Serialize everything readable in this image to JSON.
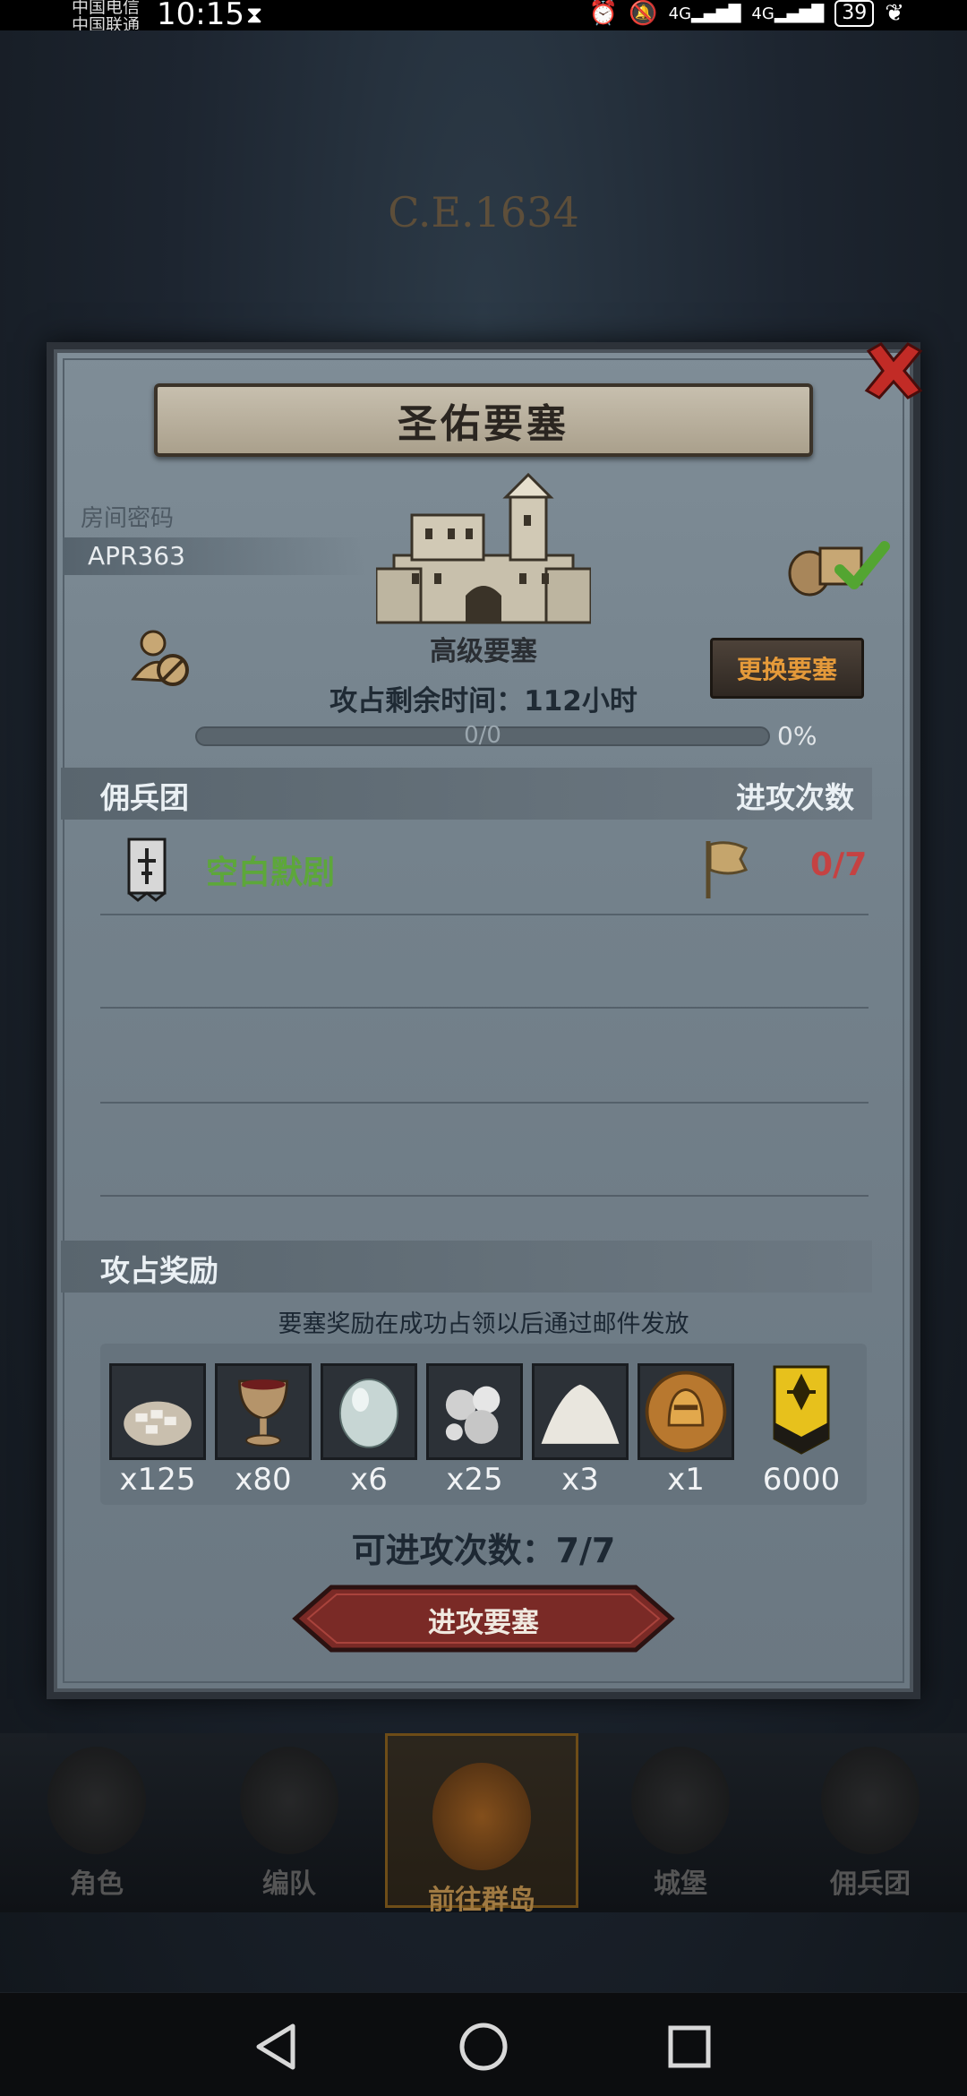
{
  "status_bar": {
    "carrier_1": "中国电信",
    "carrier_2": "中国联通",
    "time": "10:15",
    "network_1": "4G",
    "network_2": "4G",
    "battery": "39"
  },
  "background": {
    "era": "C.E.1634"
  },
  "dialog": {
    "title": "圣佑要塞",
    "room_code_label": "房间密码",
    "room_code": "APR363",
    "fortress_level": "高级要塞",
    "time_left": "攻占剩余时间：112小时",
    "switch_button": "更换要塞",
    "progress": {
      "count": "0/0",
      "percent_label": "0%",
      "value": 0
    },
    "mercenary_section": {
      "title": "佣兵团",
      "attack_header": "进攻次数",
      "rows": [
        {
          "name": "空白默剧",
          "attacks": "0/7"
        }
      ]
    },
    "reward_section": {
      "title": "攻占奖励",
      "note": "要塞奖励在成功占领以后通过邮件发放",
      "items": [
        {
          "icon": "silver-sack-icon",
          "qty": "x125"
        },
        {
          "icon": "goblet-icon",
          "qty": "x80"
        },
        {
          "icon": "gem-stone-icon",
          "qty": "x6"
        },
        {
          "icon": "pearls-icon",
          "qty": "x25"
        },
        {
          "icon": "salt-pile-icon",
          "qty": "x3"
        },
        {
          "icon": "helmet-medal-icon",
          "qty": "x1"
        },
        {
          "icon": "rank-badge-icon",
          "qty": "6000"
        }
      ]
    },
    "attacks_available": "可进攻次数：7/7",
    "attack_button": "进攻要塞"
  },
  "bottom_nav": [
    {
      "label": "角色",
      "active": false
    },
    {
      "label": "编队",
      "active": false
    },
    {
      "label": "前往群岛",
      "active": true
    },
    {
      "label": "城堡",
      "active": false
    },
    {
      "label": "佣兵团",
      "active": false
    }
  ],
  "colors": {
    "merc_name": "#5da73a",
    "attack_count": "#c54242",
    "switch_button_text": "#e59a3a",
    "dialog_bg": "#7a8892"
  }
}
